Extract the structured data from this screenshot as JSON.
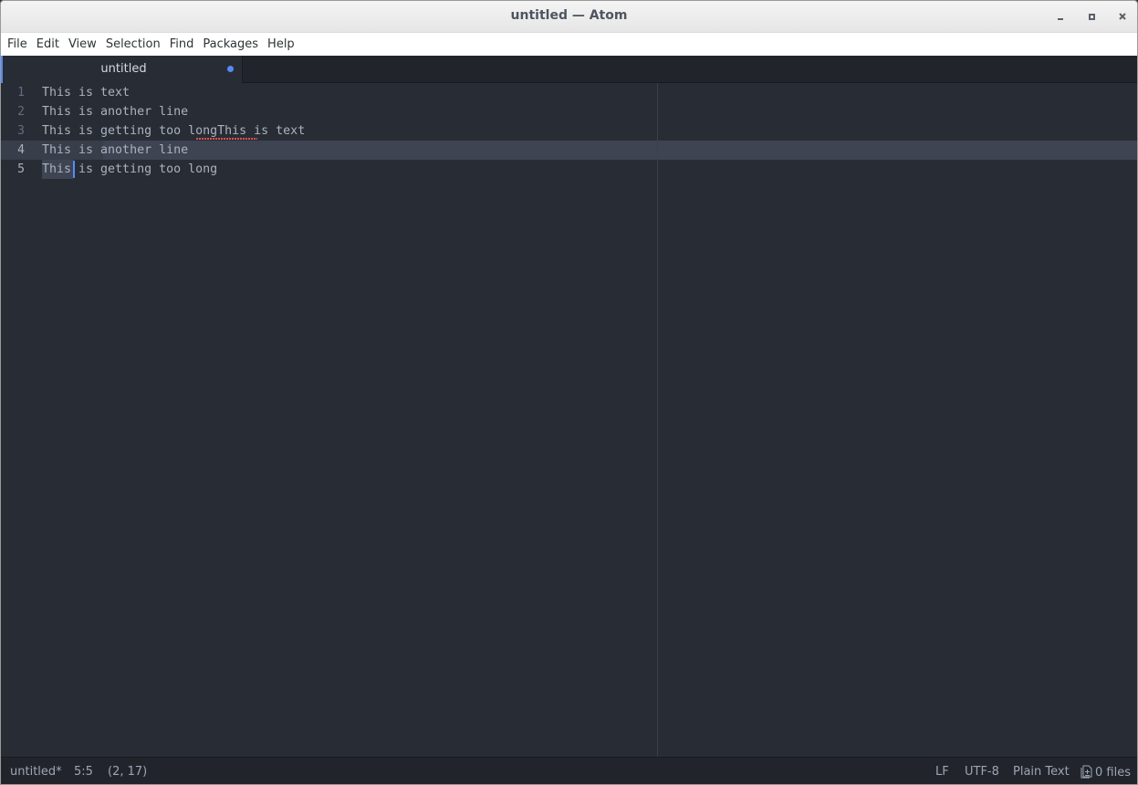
{
  "window": {
    "title": "untitled — Atom",
    "controls": [
      "minimize",
      "maximize",
      "close"
    ]
  },
  "menubar": {
    "items": [
      "File",
      "Edit",
      "View",
      "Selection",
      "Find",
      "Packages",
      "Help"
    ]
  },
  "tabs": [
    {
      "title": "untitled",
      "modified": true,
      "active": true
    }
  ],
  "editor": {
    "lines": [
      {
        "number": "1",
        "text": "This is text"
      },
      {
        "number": "2",
        "text": "This is another line"
      },
      {
        "number": "3",
        "text": "This is getting too longThis is text"
      },
      {
        "number": "4",
        "text": "This is another line"
      },
      {
        "number": "5",
        "text": "This is getting too long"
      }
    ],
    "spellcheck_error": "longThis",
    "selection": {
      "start": "4:9",
      "end": "5:5"
    },
    "cursor": "5:5",
    "colors": {
      "background": "#282c34",
      "text": "#abb2bf",
      "cursor": "#528bff",
      "selection": "#3e4451",
      "spell_error": "#e05252"
    }
  },
  "statusbar": {
    "file": "untitled*",
    "cursor_position": "5:5",
    "selection_count": "(2, 17)",
    "line_ending": "LF",
    "encoding": "UTF-8",
    "grammar": "Plain Text",
    "files": "0 files"
  },
  "accent": "#568af2"
}
